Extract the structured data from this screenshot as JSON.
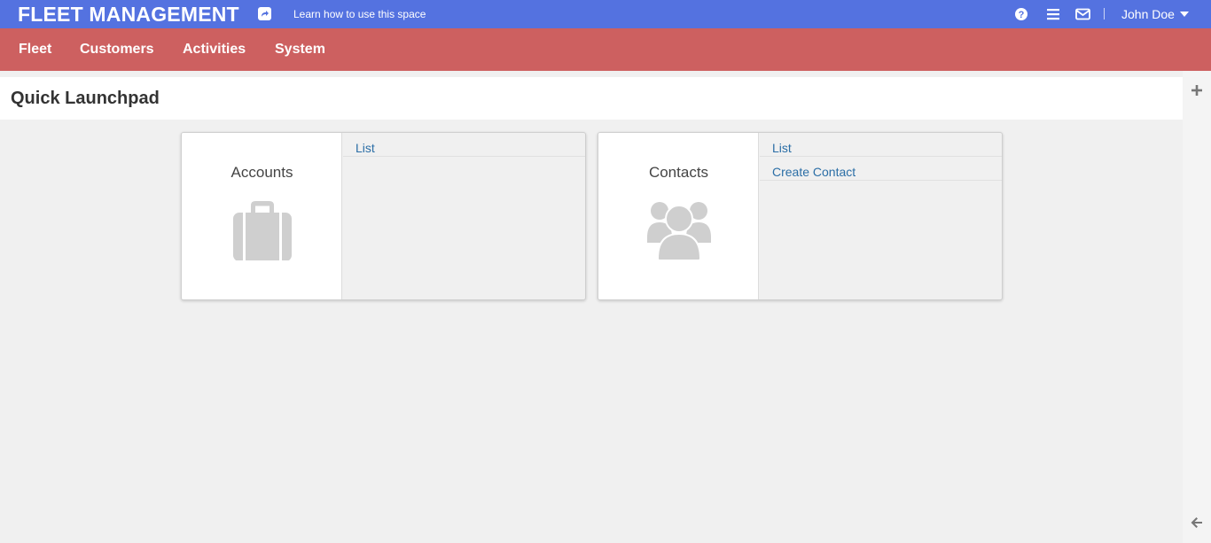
{
  "header": {
    "brand": "FLEET MANAGEMENT",
    "learn_link": "Learn how to use this space",
    "user_name": "John Doe",
    "icons": [
      "share-icon",
      "help-icon",
      "menu-icon",
      "mail-icon",
      "caret-down-icon"
    ]
  },
  "nav": {
    "items": [
      {
        "label": "Fleet"
      },
      {
        "label": "Customers"
      },
      {
        "label": "Activities"
      },
      {
        "label": "System"
      }
    ]
  },
  "page": {
    "title": "Quick Launchpad"
  },
  "cards": [
    {
      "title": "Accounts",
      "icon": "briefcase-icon",
      "links": [
        "List"
      ]
    },
    {
      "title": "Contacts",
      "icon": "users-icon",
      "links": [
        "List",
        "Create Contact"
      ]
    }
  ],
  "rail": {
    "icons": [
      "plus-icon",
      "arrow-left-icon"
    ]
  },
  "colors": {
    "topbar": "#5472e0",
    "navbar": "#cd6060",
    "link": "#2b6ea6",
    "icon_gray": "#cfcfcf"
  }
}
